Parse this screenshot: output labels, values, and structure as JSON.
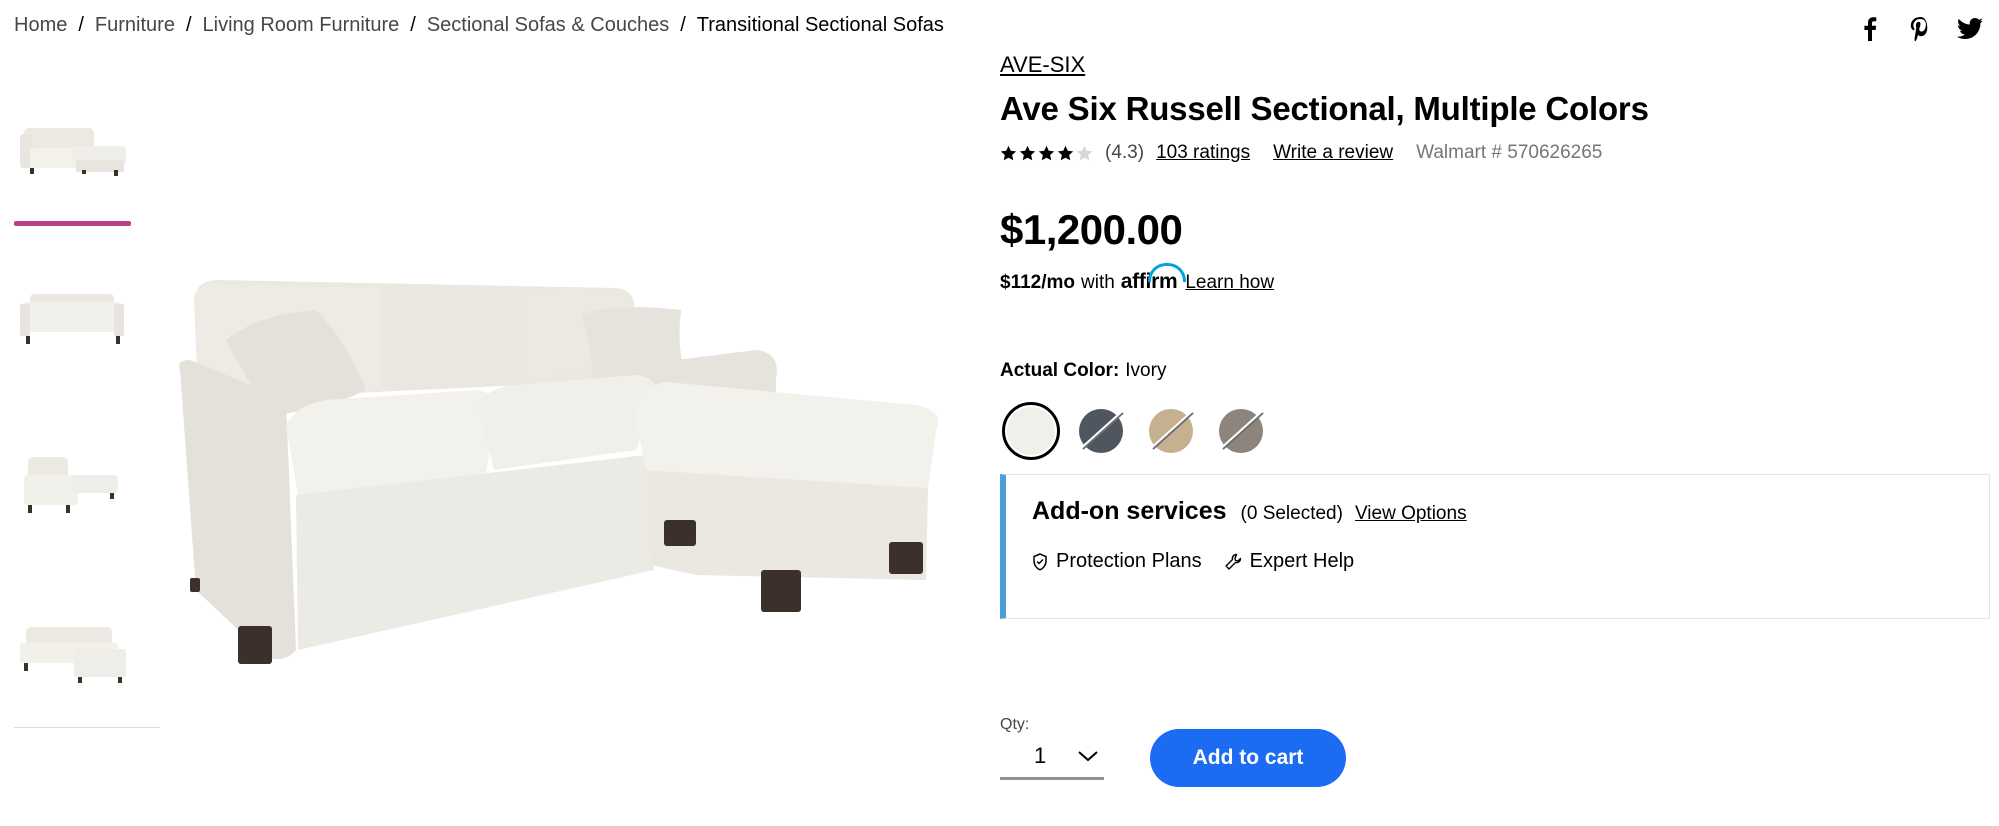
{
  "breadcrumb": {
    "items": [
      "Home",
      "Furniture",
      "Living Room Furniture",
      "Sectional Sofas & Couches",
      "Transitional Sectional Sofas"
    ],
    "separator": "/"
  },
  "share": {
    "icons": [
      "facebook-icon",
      "pinterest-icon",
      "twitter-icon"
    ]
  },
  "gallery": {
    "thumbnails": [
      {
        "alt": "sectional-front-view",
        "active": true
      },
      {
        "alt": "sectional-back-view",
        "active": false
      },
      {
        "alt": "sectional-side-view",
        "active": false
      },
      {
        "alt": "sectional-chaise-view",
        "active": false
      }
    ]
  },
  "product": {
    "brand": "AVE-SIX",
    "title": "Ave Six Russell Sectional, Multiple Colors",
    "rating": 4.3,
    "rating_text": "(4.3)",
    "ratings_link": "103 ratings",
    "review_link": "Write a review",
    "item_number": "Walmart # 570626265",
    "price": "$1,200.00",
    "affirm": {
      "monthly": "$112/mo",
      "with": "with",
      "logo": "affirm",
      "learn": "Learn how"
    },
    "color": {
      "label": "Actual Color:",
      "value": "Ivory",
      "swatches": [
        {
          "name": "Ivory",
          "color": "#f1efea",
          "selected": true,
          "available": true
        },
        {
          "name": "Charcoal",
          "color": "#4f5660",
          "selected": false,
          "available": false
        },
        {
          "name": "Taupe",
          "color": "#c6b08f",
          "selected": false,
          "available": false
        },
        {
          "name": "Grey",
          "color": "#8d847b",
          "selected": false,
          "available": false
        }
      ]
    }
  },
  "addons": {
    "title": "Add-on services",
    "selected": "(0 Selected)",
    "view": "View Options",
    "items": [
      {
        "label": "Protection Plans",
        "icon": "shield-icon"
      },
      {
        "label": "Expert Help",
        "icon": "wrench-icon"
      }
    ]
  },
  "purchase": {
    "qty_label": "Qty:",
    "qty_value": "1",
    "cart_label": "Add to cart"
  },
  "colors": {
    "accent": "#1b6cf2",
    "thumb_active": "#bd3c8e",
    "addon_border": "#4a9fd8"
  }
}
